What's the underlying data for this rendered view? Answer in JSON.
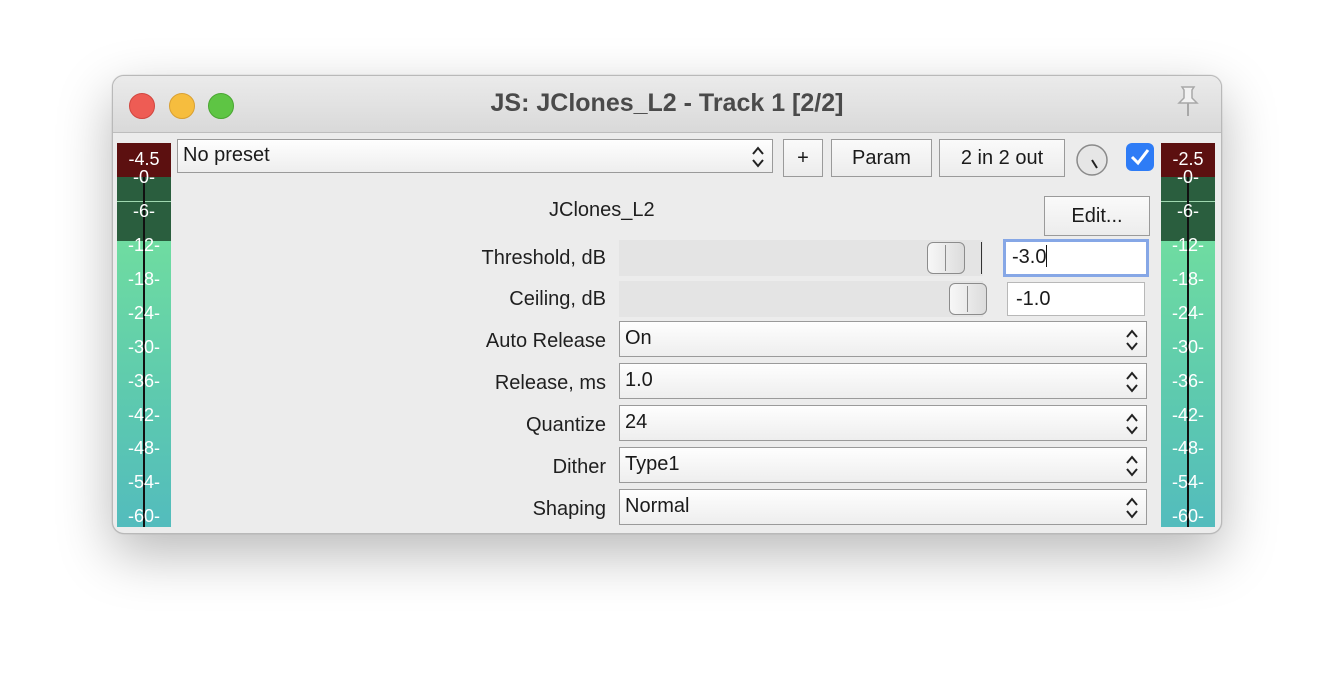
{
  "window": {
    "title": "JS: JClones_L2 - Track 1 [2/2]"
  },
  "toolbar": {
    "preset": "No preset",
    "add_label": "+",
    "param_label": "Param",
    "io_label": "2 in 2 out",
    "enabled": true
  },
  "meters": {
    "left": {
      "peak": "-4.5"
    },
    "right": {
      "peak": "-2.5"
    },
    "ticks": [
      "-0-",
      "-6-",
      "-12-",
      "-18-",
      "-24-",
      "-30-",
      "-36-",
      "-42-",
      "-48-",
      "-54-",
      "-60-"
    ]
  },
  "plugin": {
    "name": "JClones_L2",
    "edit_label": "Edit..."
  },
  "params": {
    "threshold": {
      "label": "Threshold, dB",
      "value": "-3.0"
    },
    "ceiling": {
      "label": "Ceiling, dB",
      "value": "-1.0"
    },
    "auto_release": {
      "label": "Auto Release",
      "value": "On"
    },
    "release": {
      "label": "Release, ms",
      "value": "1.0"
    },
    "quantize": {
      "label": "Quantize",
      "value": "24"
    },
    "dither": {
      "label": "Dither",
      "value": "Type1"
    },
    "shaping": {
      "label": "Shaping",
      "value": "Normal"
    }
  },
  "colors": {
    "accent": "#2e7cf6",
    "meter_peak": "#5c1010",
    "meter_green": "#7de99d"
  }
}
